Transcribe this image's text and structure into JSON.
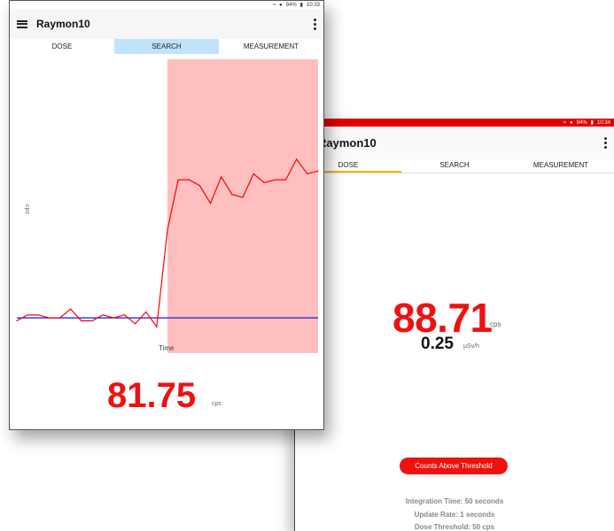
{
  "front_window": {
    "status": {
      "battery": "94%",
      "time": "10:33"
    },
    "app_title": "Raymon10",
    "tabs": [
      {
        "label": "DOSE",
        "active": false
      },
      {
        "label": "SEARCH",
        "active": true
      },
      {
        "label": "MEASUREMENT",
        "active": false
      }
    ],
    "cps_value": "81.75",
    "cps_unit": "cps"
  },
  "back_window": {
    "status": {
      "battery": "94%",
      "time": "10:34"
    },
    "app_title": "Raymon10",
    "tabs": [
      {
        "label": "DOSE",
        "active": true
      },
      {
        "label": "SEARCH",
        "active": false
      },
      {
        "label": "MEASUREMENT",
        "active": false
      }
    ],
    "cps_value": "88.71",
    "cps_unit": "cps",
    "dose_value": "0.25",
    "dose_unit": "µSv/h",
    "threshold_button": "Counts Above Threshold",
    "info": {
      "integration_time": "Integration Time: 50 seconds",
      "update_rate": "Update Rate: 1 seconds",
      "dose_threshold": "Dose Threshold: 50 cps"
    }
  },
  "chart_data": {
    "type": "line",
    "xlabel": "Time",
    "ylabel": "cps",
    "highlight_color": "#ffbfbf",
    "series": [
      {
        "color": "#ff0000",
        "values": [
          0.11,
          0.13,
          0.13,
          0.12,
          0.12,
          0.15,
          0.11,
          0.11,
          0.13,
          0.12,
          0.13,
          0.1,
          0.14,
          0.09,
          0.42,
          0.59,
          0.59,
          0.57,
          0.51,
          0.6,
          0.54,
          0.53,
          0.61,
          0.58,
          0.59,
          0.59,
          0.66,
          0.61,
          0.62
        ]
      },
      {
        "color": "#2b2bd6",
        "values": [
          0.12,
          0.12
        ]
      }
    ],
    "highlight_start_index": 14
  },
  "colors": {
    "accent_red": "#ee1111",
    "tab_active_bg": "#bfe3fb",
    "tab_underline": "#f3b400"
  }
}
